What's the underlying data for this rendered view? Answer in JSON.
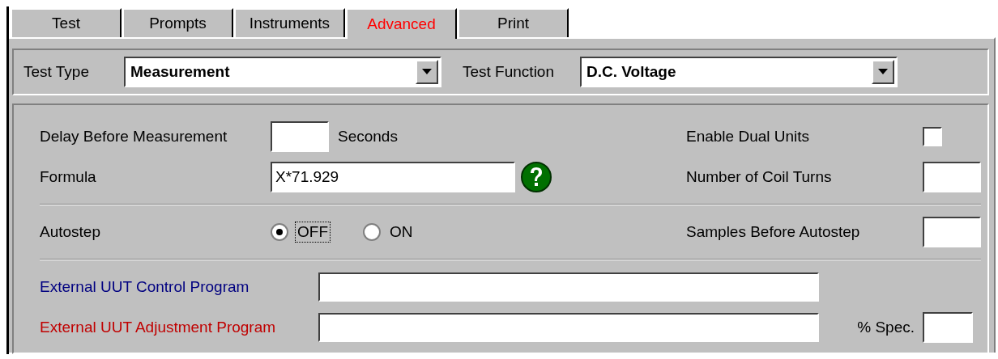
{
  "tabs": [
    {
      "label": "Test",
      "selected": false
    },
    {
      "label": "Prompts",
      "selected": false
    },
    {
      "label": "Instruments",
      "selected": false
    },
    {
      "label": "Advanced",
      "selected": true
    },
    {
      "label": "Print",
      "selected": false
    }
  ],
  "test_type": {
    "label": "Test Type",
    "value": "Measurement"
  },
  "test_function": {
    "label": "Test Function",
    "value": "D.C. Voltage"
  },
  "delay": {
    "label": "Delay Before Measurement",
    "unit": "Seconds"
  },
  "formula": {
    "label": "Formula",
    "value": "X*71.929"
  },
  "enable_dual_units": {
    "label": "Enable Dual Units",
    "checked": false
  },
  "coil_turns": {
    "label": "Number of Coil Turns"
  },
  "autostep": {
    "label": "Autostep",
    "options": [
      {
        "label": "OFF",
        "selected": true,
        "focused": true
      },
      {
        "label": "ON",
        "selected": false,
        "focused": false
      }
    ]
  },
  "samples_before_autostep": {
    "label": "Samples Before Autostep"
  },
  "programs": [
    {
      "label": "External UUT Control Program",
      "color": "#000080"
    },
    {
      "label": "External UUT Adjustment Program",
      "color": "#c00000"
    }
  ],
  "spec": {
    "label": "% Spec."
  }
}
